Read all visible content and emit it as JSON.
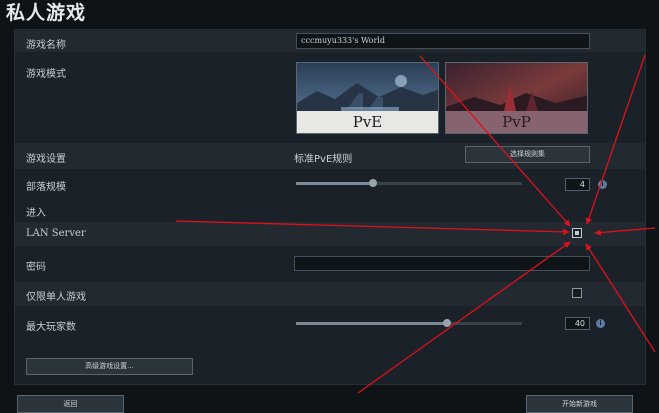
{
  "page": {
    "title": "私人游戏"
  },
  "rows": {
    "game_name": {
      "label": "游戏名称",
      "value": "cccmuyu333's World"
    },
    "game_mode": {
      "label": "游戏模式",
      "options": [
        {
          "label": "PvE",
          "selected": true
        },
        {
          "label": "PvP",
          "selected": false
        }
      ]
    },
    "game_settings": {
      "label": "游戏设置",
      "value": "标准PvE规则",
      "button": "选择规则集"
    },
    "clan_size": {
      "label": "部落规模",
      "value": "4",
      "fraction": 0.34
    },
    "join_section": {
      "label": "进入"
    },
    "lan_server": {
      "label": "LAN Server",
      "checked": true
    },
    "password": {
      "label": "密码",
      "value": ""
    },
    "single_player": {
      "label": "仅限单人游戏",
      "checked": false
    },
    "max_players": {
      "label": "最大玩家数",
      "value": "40",
      "fraction": 0.67
    }
  },
  "buttons": {
    "advanced": "高级游戏设置...",
    "back": "返回",
    "start": "开始新游戏"
  },
  "icons": {
    "info": "info-icon"
  },
  "colors": {
    "annotation_arrow": "#e0101a",
    "background": "#0e1318"
  }
}
